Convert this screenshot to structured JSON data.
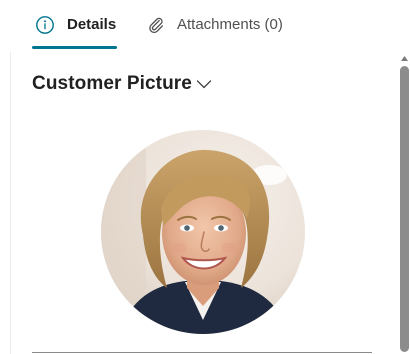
{
  "tabs": [
    {
      "label": "Details",
      "icon": "info-icon",
      "selected": true
    },
    {
      "label": "Attachments (0)",
      "icon": "paperclip-icon",
      "selected": false
    }
  ],
  "section": {
    "title": "Customer Picture",
    "toggle_icon": "chevron-down-icon"
  },
  "picture": {
    "subject": "customer-photo",
    "shape": "circle"
  },
  "colors": {
    "accent": "#00758f",
    "text_primary": "#212121",
    "text_secondary": "#505050",
    "scrollbar": "#8c8c8c"
  }
}
